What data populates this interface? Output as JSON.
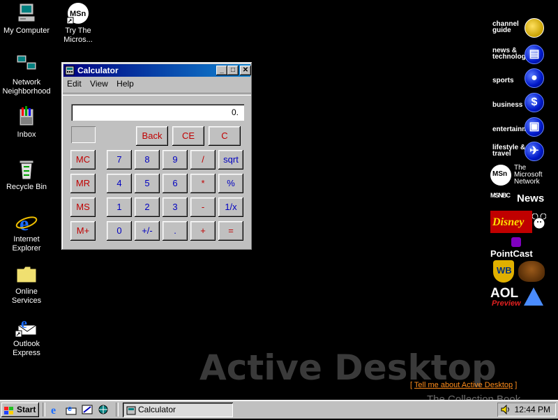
{
  "desktop": {
    "icons": [
      {
        "label": "My Computer"
      },
      {
        "label": "Try The Micros..."
      },
      {
        "label": "Network Neighborhood"
      },
      {
        "label": "Inbox"
      },
      {
        "label": "Recycle Bin"
      },
      {
        "label": "Internet Explorer"
      },
      {
        "label": "Online Services"
      },
      {
        "label": "Outlook Express"
      }
    ],
    "msn_logo": "MSn"
  },
  "channel_bar": {
    "channels": [
      {
        "label": "channel guide"
      },
      {
        "label": "news & technology"
      },
      {
        "label": "sports"
      },
      {
        "label": "business"
      },
      {
        "label": "entertainment"
      },
      {
        "label": "lifestyle & travel"
      }
    ],
    "logos": {
      "msn": "The Microsoft Network",
      "msn_mark": "MSn",
      "msnbc": "MSNBC",
      "msnbc_news": "News",
      "disney": "Disney",
      "pointcast": "PointCast",
      "warner": "WB",
      "aol": "AOL",
      "aol_preview": "Preview"
    }
  },
  "calculator": {
    "title": "Calculator",
    "title_buttons": {
      "minimize": "_",
      "maximize": "□",
      "close": "✕"
    },
    "menu": [
      "Edit",
      "View",
      "Help"
    ],
    "display_value": "0.",
    "buttons": {
      "back": "Back",
      "ce": "CE",
      "c": "C",
      "mc": "MC",
      "mr": "MR",
      "ms": "MS",
      "mplus": "M+",
      "d7": "7",
      "d8": "8",
      "d9": "9",
      "div": "/",
      "sqrt": "sqrt",
      "d4": "4",
      "d5": "5",
      "d6": "6",
      "mul": "*",
      "pct": "%",
      "d1": "1",
      "d2": "2",
      "d3": "3",
      "sub": "-",
      "inv": "1/x",
      "d0": "0",
      "sign": "+/-",
      "dot": ".",
      "add": "+",
      "eq": "="
    }
  },
  "active_desktop": {
    "heading": "Active Desktop",
    "link_prefix": "[ ",
    "link": "Tell me about Active Desktop",
    "link_suffix": " ]"
  },
  "watermark": "The Collection Book",
  "taskbar": {
    "start_label": "Start",
    "task_label": "Calculator",
    "clock": "12:44 PM"
  },
  "colors": {
    "desktop_bg": "#000000",
    "title_active": "#000080",
    "calc_digit": "#0000c0",
    "calc_op": "#c00000",
    "link_orange": "#ff8c1a"
  }
}
